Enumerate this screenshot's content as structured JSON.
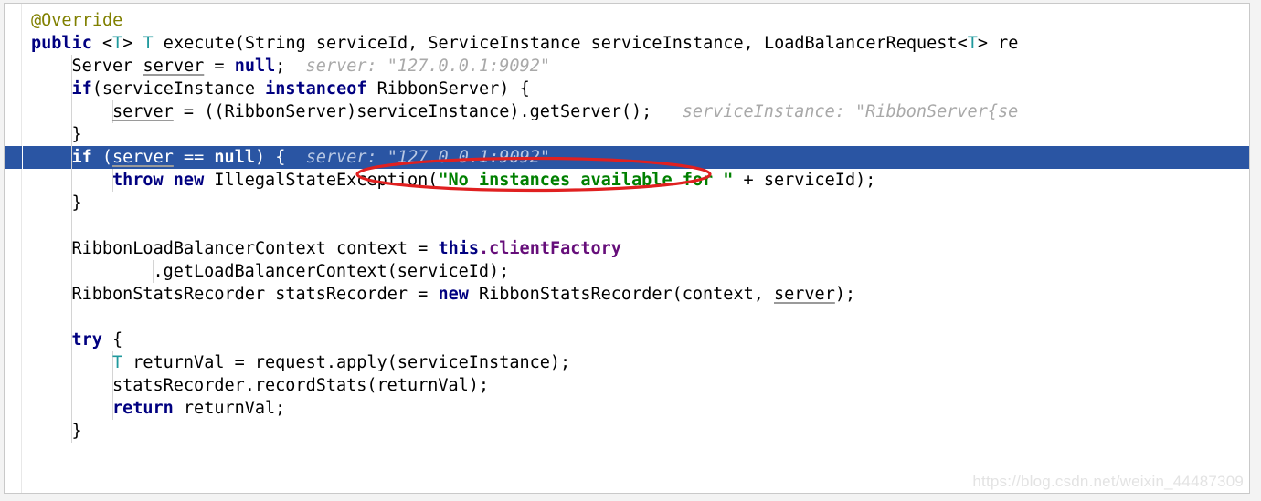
{
  "editor": {
    "language": "java",
    "theme": "intellij-light",
    "colors": {
      "background": "#ffffff",
      "selection_blue": "#2a55a3",
      "annotation_keyword": "#808000",
      "keyword": "#000080",
      "string": "#008000",
      "field": "#660e7a",
      "generic_type": "#20999d",
      "inline_hint": "#a9a9a9",
      "annotation_red": "#e02020",
      "indent_guide": "#d4d4d4",
      "watermark": "#e3e3e3"
    },
    "selected_line_index": 6,
    "lines": [
      {
        "index": 0,
        "indent": 0,
        "tokens": [
          {
            "t": "anno",
            "s": "@Override"
          }
        ]
      },
      {
        "index": 1,
        "indent": 0,
        "tokens": [
          {
            "t": "kw",
            "s": "public"
          },
          {
            "t": "plain",
            "s": " "
          },
          {
            "t": "punc",
            "s": "<"
          },
          {
            "t": "type",
            "s": "T"
          },
          {
            "t": "punc",
            "s": "> "
          },
          {
            "t": "type",
            "s": "T"
          },
          {
            "t": "plain",
            "s": " execute(String serviceId, ServiceInstance serviceInstance, LoadBalancerRequest"
          },
          {
            "t": "punc",
            "s": "<"
          },
          {
            "t": "type",
            "s": "T"
          },
          {
            "t": "punc",
            "s": ">"
          },
          {
            "t": "plain",
            "s": " re"
          }
        ]
      },
      {
        "index": 2,
        "indent": 1,
        "tokens": [
          {
            "t": "plain",
            "s": "Server "
          },
          {
            "t": "var",
            "s": "server"
          },
          {
            "t": "plain",
            "s": " = "
          },
          {
            "t": "kw",
            "s": "null"
          },
          {
            "t": "plain",
            "s": ";  "
          },
          {
            "t": "hint",
            "s": "server: \"127.0.0.1:9092\""
          }
        ]
      },
      {
        "index": 3,
        "indent": 1,
        "tokens": [
          {
            "t": "kw",
            "s": "if"
          },
          {
            "t": "plain",
            "s": "(serviceInstance "
          },
          {
            "t": "kw",
            "s": "instanceof"
          },
          {
            "t": "plain",
            "s": " RibbonServer) {"
          }
        ]
      },
      {
        "index": 4,
        "indent": 2,
        "tokens": [
          {
            "t": "var",
            "s": "server"
          },
          {
            "t": "plain",
            "s": " = ((RibbonServer)serviceInstance).getServer();   "
          },
          {
            "t": "hint",
            "s": "serviceInstance: \"RibbonServer{se"
          }
        ]
      },
      {
        "index": 5,
        "indent": 1,
        "tokens": [
          {
            "t": "plain",
            "s": "}"
          }
        ]
      },
      {
        "index": 6,
        "indent": 1,
        "tokens": [
          {
            "t": "kw",
            "s": "if"
          },
          {
            "t": "plain",
            "s": " ("
          },
          {
            "t": "var",
            "s": "server"
          },
          {
            "t": "plain",
            "s": " == "
          },
          {
            "t": "kw",
            "s": "null"
          },
          {
            "t": "plain",
            "s": ") {  "
          },
          {
            "t": "hint",
            "s": "server: \"127.0.0.1:9092\""
          }
        ]
      },
      {
        "index": 7,
        "indent": 2,
        "tokens": [
          {
            "t": "kw",
            "s": "throw"
          },
          {
            "t": "plain",
            "s": " "
          },
          {
            "t": "kw",
            "s": "new"
          },
          {
            "t": "plain",
            "s": " IllegalStateException("
          },
          {
            "t": "str",
            "s": "\"No instances available for \""
          },
          {
            "t": "plain",
            "s": " + serviceId);"
          }
        ]
      },
      {
        "index": 8,
        "indent": 1,
        "tokens": [
          {
            "t": "plain",
            "s": "}"
          }
        ]
      },
      {
        "index": 9,
        "indent": 0,
        "tokens": []
      },
      {
        "index": 10,
        "indent": 1,
        "tokens": [
          {
            "t": "plain",
            "s": "RibbonLoadBalancerContext context = "
          },
          {
            "t": "kw",
            "s": "this"
          },
          {
            "t": "field",
            "s": ".clientFactory"
          }
        ]
      },
      {
        "index": 11,
        "indent": 3,
        "tokens": [
          {
            "t": "plain",
            "s": ".getLoadBalancerContext(serviceId);"
          }
        ]
      },
      {
        "index": 12,
        "indent": 1,
        "tokens": [
          {
            "t": "plain",
            "s": "RibbonStatsRecorder statsRecorder = "
          },
          {
            "t": "kw",
            "s": "new"
          },
          {
            "t": "plain",
            "s": " RibbonStatsRecorder(context, "
          },
          {
            "t": "var",
            "s": "server"
          },
          {
            "t": "plain",
            "s": ");"
          }
        ]
      },
      {
        "index": 13,
        "indent": 0,
        "tokens": []
      },
      {
        "index": 14,
        "indent": 1,
        "tokens": [
          {
            "t": "kw",
            "s": "try"
          },
          {
            "t": "plain",
            "s": " {"
          }
        ]
      },
      {
        "index": 15,
        "indent": 2,
        "tokens": [
          {
            "t": "type",
            "s": "T"
          },
          {
            "t": "plain",
            "s": " returnVal = request.apply(serviceInstance);"
          }
        ]
      },
      {
        "index": 16,
        "indent": 2,
        "tokens": [
          {
            "t": "plain",
            "s": "statsRecorder.recordStats(returnVal);"
          }
        ]
      },
      {
        "index": 17,
        "indent": 2,
        "tokens": [
          {
            "t": "kw",
            "s": "return"
          },
          {
            "t": "plain",
            "s": " returnVal;"
          }
        ]
      },
      {
        "index": 18,
        "indent": 1,
        "tokens": [
          {
            "t": "plain",
            "s": "}"
          }
        ]
      }
    ]
  },
  "annotation": {
    "shape": "ellipse",
    "color": "#e02020",
    "encircles": "server: \"127.0.0.1:9092\""
  },
  "watermark": {
    "text": "https://blog.csdn.net/weixin_44487309"
  }
}
